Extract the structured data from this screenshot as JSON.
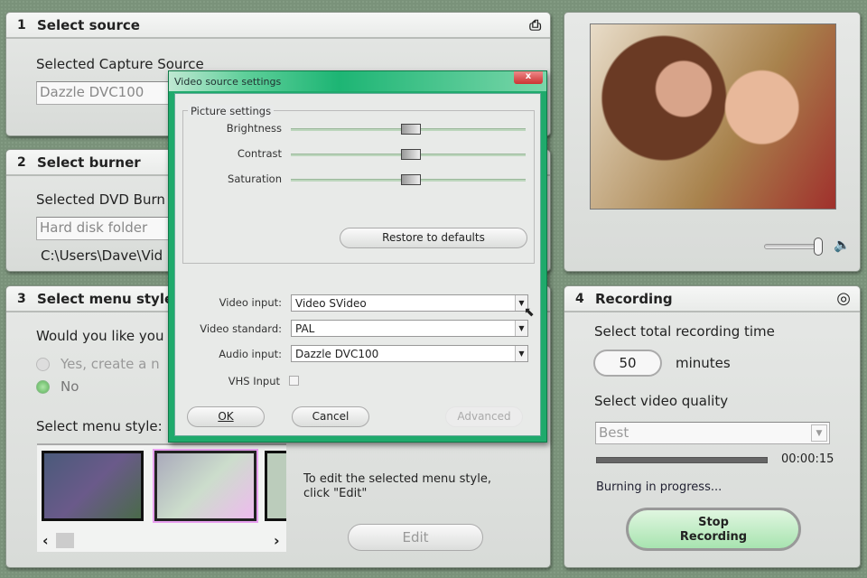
{
  "panel1": {
    "num": "1",
    "title": "Select source",
    "label": "Selected Capture Source",
    "value": "Dazzle DVC100"
  },
  "panel2": {
    "num": "2",
    "title": "Select burner",
    "label": "Selected DVD Burn",
    "value": "Hard disk folder",
    "path": "C:\\Users\\Dave\\Vid"
  },
  "panel3": {
    "num": "3",
    "title": "Select menu style",
    "question": "Would you like you",
    "radio_yes": "Yes, create a n",
    "radio_no": "No",
    "radio_selected": "No",
    "style_label": "Select menu style:",
    "edit_hint": "To edit the selected menu style, click \"Edit\"",
    "edit_button": "Edit",
    "scroll_left": "‹",
    "scroll_right": "›"
  },
  "preview": {
    "volume": 0.95
  },
  "panel4": {
    "num": "4",
    "title": "Recording",
    "time_label": "Select total recording time",
    "minutes_value": "50",
    "minutes_unit": "minutes",
    "quality_label": "Select video quality",
    "quality_value": "Best",
    "progress": 1.0,
    "elapsed": "00:00:15",
    "status": "Burning in progress...",
    "stop_button_line1": "Stop",
    "stop_button_line2": "Recording"
  },
  "dialog": {
    "title": "Video source settings",
    "close": "x",
    "group": "Picture settings",
    "sliders": [
      {
        "label": "Brightness",
        "value": 0.5
      },
      {
        "label": "Contrast",
        "value": 0.5
      },
      {
        "label": "Saturation",
        "value": 0.5
      }
    ],
    "restore": "Restore to defaults",
    "video_input_label": "Video input:",
    "video_input": "Video SVideo",
    "video_standard_label": "Video standard:",
    "video_standard": "PAL",
    "audio_input_label": "Audio input:",
    "audio_input": "Dazzle DVC100",
    "vhs_label": "VHS Input",
    "vhs_checked": false,
    "ok": "OK",
    "cancel": "Cancel",
    "advanced": "Advanced"
  },
  "colors": {
    "accent": "#1faa6c",
    "background": "#7a927a"
  }
}
